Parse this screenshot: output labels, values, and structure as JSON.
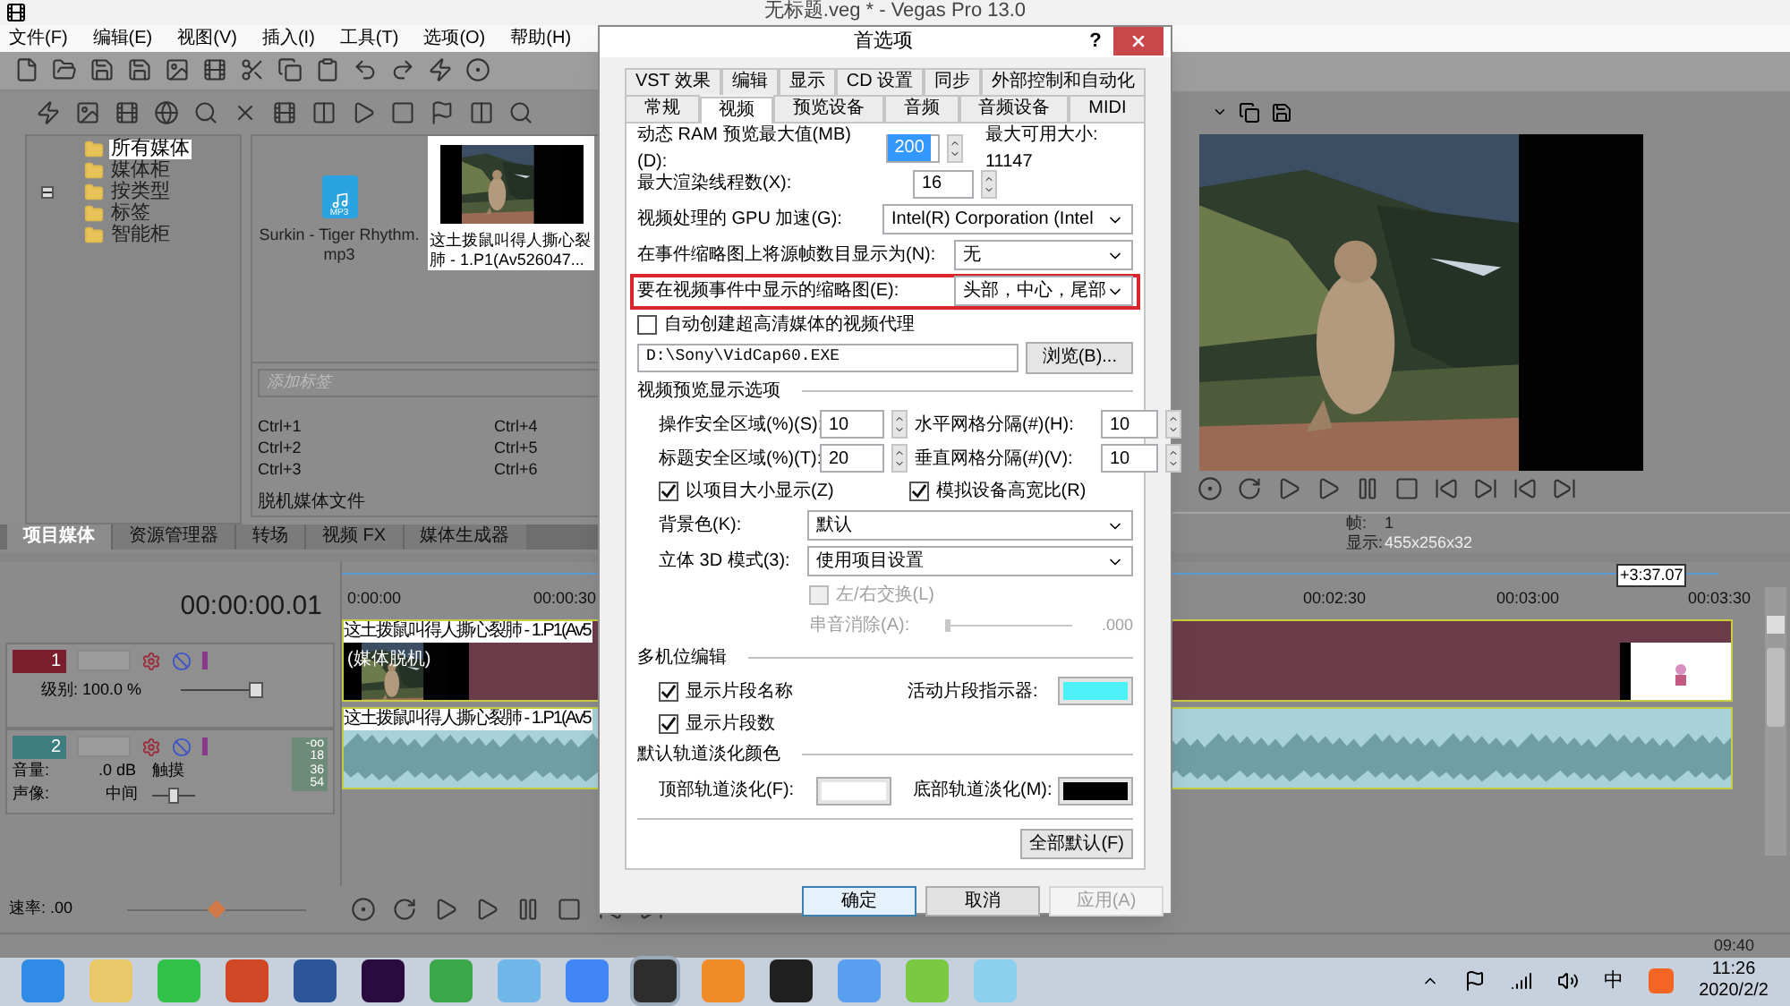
{
  "window": {
    "title": "无标题.veg * - Vegas Pro 13.0"
  },
  "menu": [
    "文件(F)",
    "编辑(E)",
    "视图(V)",
    "插入(I)",
    "工具(T)",
    "选项(O)",
    "帮助(H)"
  ],
  "tree": [
    {
      "label": "所有媒体",
      "selected": true
    },
    {
      "label": "媒体柜",
      "selected": false
    },
    {
      "label": "按类型",
      "selected": false,
      "expanded": false
    },
    {
      "label": "标签",
      "selected": false
    },
    {
      "label": "智能柜",
      "selected": false
    }
  ],
  "media": [
    {
      "kind": "audio",
      "name": "Surkin - Tiger Rhythm.mp3",
      "badge": "MP3",
      "selected": false
    },
    {
      "kind": "video",
      "name": "这土拨鼠叫得人撕心裂肺 - 1.P1(Av526047...",
      "selected": true
    }
  ],
  "tag_field": {
    "placeholder": "添加标签"
  },
  "shortcuts": [
    "Ctrl+1",
    "Ctrl+4",
    "Ctrl+2",
    "Ctrl+5",
    "Ctrl+3",
    "Ctrl+6"
  ],
  "offline_label": "脱机媒体文件",
  "bottom_tabs": [
    {
      "label": "项目媒体",
      "selected": true
    },
    {
      "label": "资源管理器",
      "selected": false
    },
    {
      "label": "转场",
      "selected": false
    },
    {
      "label": "视频 FX",
      "selected": false
    },
    {
      "label": "媒体生成器",
      "selected": false
    }
  ],
  "preview": {
    "frame_label": "帧:",
    "frame": "1",
    "display_label": "显示:",
    "display": "455x256x32"
  },
  "timeline": {
    "timecode": "00:00:00.01",
    "length": "+3:37.07",
    "ruler": [
      "0:00:00",
      "00:00:30",
      "00:02:30",
      "00:03:00",
      "00:03:30"
    ],
    "tracks": [
      {
        "kind": "video",
        "number": "1",
        "level_label": "级别: 100.0 %",
        "level": 1.0,
        "clip": "这土拨鼠叫得人撕心裂肺 - 1.P1(Av5",
        "clip_note": "(媒体脱机)"
      },
      {
        "kind": "audio",
        "number": "2",
        "volume_label": "音量:",
        "volume": ".0 dB",
        "pan_label": "声像:",
        "pan": "中间",
        "level": 0.5,
        "mode": "触摸",
        "meter": [
          "-oo",
          "18",
          "36",
          "54"
        ],
        "clip": "这土拨鼠叫得人撕心裂肺 - 1.P1(Av5"
      }
    ],
    "rate": {
      "label": "速率: .00",
      "level": 0.5
    },
    "status": "09:40"
  },
  "dialog": {
    "title": "首选项",
    "help": "?",
    "tab_rows": [
      [
        {
          "label": "VST 效果",
          "selected": false
        },
        {
          "label": "编辑",
          "selected": false
        },
        {
          "label": "显示",
          "selected": false
        },
        {
          "label": "CD 设置",
          "selected": false
        },
        {
          "label": "同步",
          "selected": false
        },
        {
          "label": "外部控制和自动化",
          "selected": false
        }
      ],
      [
        {
          "label": "常规",
          "selected": false
        },
        {
          "label": "视频",
          "selected": true
        },
        {
          "label": "预览设备",
          "selected": false
        },
        {
          "label": "音频",
          "selected": false
        },
        {
          "label": "音频设备",
          "selected": false
        },
        {
          "label": "MIDI",
          "selected": false
        }
      ]
    ],
    "rows": [
      {
        "kind": "spin",
        "label": "动态 RAM 预览最大值(MB)(D):",
        "value": "200",
        "selected": true,
        "note": "最大可用大小: 11147"
      },
      {
        "kind": "spin",
        "label": "最大渲染线程数(X):",
        "value": "16",
        "selected": false
      },
      {
        "kind": "select",
        "label": "视频处理的 GPU 加速(G):",
        "value": "Intel(R) Corporation (Intel"
      },
      {
        "kind": "select",
        "label": "在事件缩略图上将源帧数目显示为(N):",
        "value": "无"
      },
      {
        "kind": "select",
        "label": "要在视频事件中显示的缩略图(E):",
        "value": "头部，中心，尾部",
        "highlighted": true
      },
      {
        "kind": "checkbox",
        "label": "自动创建超高清媒体的视频代理",
        "checked": false,
        "disabled": false
      },
      {
        "kind": "path",
        "value": "D:\\Sony\\VidCap60.EXE",
        "button": "浏览(B)..."
      },
      {
        "kind": "section",
        "label": "视频预览显示选项"
      },
      {
        "kind": "spinpair",
        "items": [
          {
            "label": "操作安全区域(%)(S):",
            "value": "10"
          },
          {
            "label": "水平网格分隔(#)(H):",
            "value": "10"
          }
        ]
      },
      {
        "kind": "spinpair",
        "items": [
          {
            "label": "标题安全区域(%)(T):",
            "value": "20"
          },
          {
            "label": "垂直网格分隔(#)(V):",
            "value": "10"
          }
        ]
      },
      {
        "kind": "checkpair",
        "items": [
          {
            "label": "以项目大小显示(Z)",
            "checked": true
          },
          {
            "label": "模拟设备高宽比(R)",
            "checked": true
          }
        ]
      },
      {
        "kind": "subselect",
        "label": "背景色(K):",
        "value": "默认"
      },
      {
        "kind": "subselect",
        "label": "立体 3D 模式(3):",
        "value": "使用项目设置"
      },
      {
        "kind": "optioncheck",
        "label": "左/右交换(L)",
        "checked": false,
        "disabled": true
      },
      {
        "kind": "slider",
        "label": "串音消除(A):",
        "reading": ".000",
        "level": 0,
        "disabled": true
      },
      {
        "kind": "section",
        "label": "多机位编辑"
      },
      {
        "kind": "checkswatch",
        "label": "显示片段名称",
        "checked": true,
        "swatch_label": "活动片段指示器:",
        "color": "#4cf2f7"
      },
      {
        "kind": "subcheck",
        "label": "显示片段数",
        "checked": true,
        "disabled": false
      },
      {
        "kind": "section",
        "label": "默认轨道淡化颜色"
      },
      {
        "kind": "swatchpair",
        "items": [
          {
            "label": "顶部轨道淡化(F):",
            "color": "#ffffff"
          },
          {
            "label": "底部轨道淡化(M):",
            "color": "#000000"
          }
        ]
      },
      {
        "kind": "button",
        "label": "全部默认(F)"
      }
    ],
    "buttons": [
      {
        "label": "确定",
        "default": true,
        "disabled": false
      },
      {
        "label": "取消",
        "default": false,
        "disabled": false
      },
      {
        "label": "应用(A)",
        "default": false,
        "disabled": true
      }
    ]
  },
  "taskbar": {
    "tray_ime": "中",
    "time": "11:26",
    "date": "2020/2/2"
  }
}
